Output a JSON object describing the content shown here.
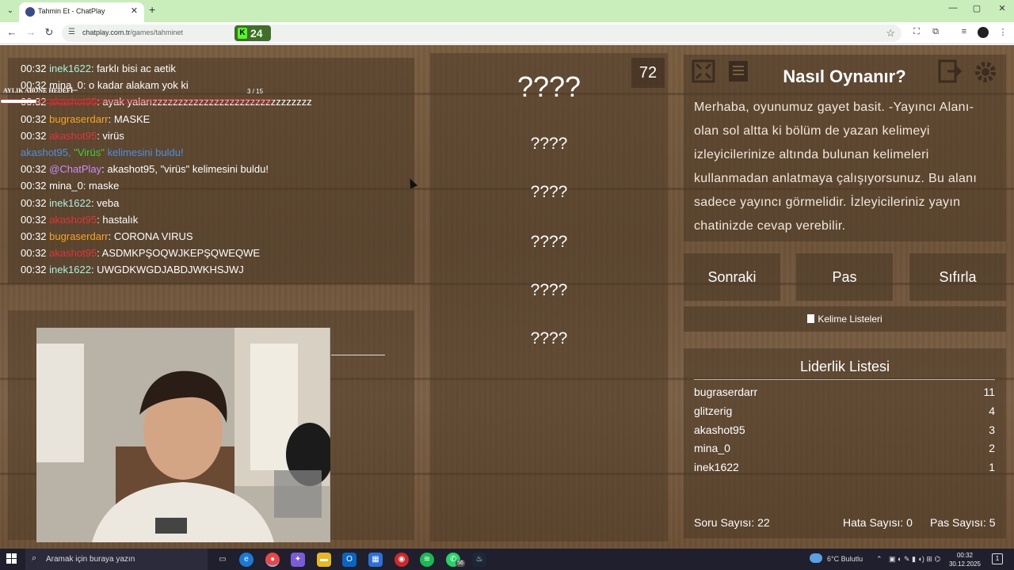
{
  "browser": {
    "tab_title": "Tahmin Et - ChatPlay",
    "tab_close": "✕",
    "new_tab": "+",
    "url_domain": "chatplay.com.tr",
    "url_path": "/games/tahminet",
    "extension_count": "24",
    "window_controls": [
      "—",
      "▢",
      "✕"
    ]
  },
  "chat": {
    "subscriber_goal_label": "AYLIK ABONE HEDEFİ",
    "subscriber_goal_count": "3 / 15",
    "subscriber_goal_progress": 0.13,
    "lines": [
      {
        "time": "00:32",
        "user": "inek1622",
        "user_class": "u-inek",
        "text": ": farklı bisi ac aetik"
      },
      {
        "time": "00:32",
        "user": "mina_0",
        "user_class": "u-mina",
        "text": ": o kadar alakam yok ki"
      },
      {
        "time": "00:32",
        "user": "akashot95",
        "user_class": "u-red",
        "text": ": ayak yalarızzzzzzzzzzzzzzzzzzzzzzzzzzzzzzz"
      },
      {
        "time": "00:32",
        "user": "bugraserdarr",
        "user_class": "u-bugra",
        "text": ": MASKE"
      },
      {
        "time": "00:32",
        "user": "akashot95",
        "user_class": "u-red",
        "text": ": virüs"
      },
      {
        "system": true,
        "pre": "akashot95, ",
        "word": "\"Virüs\"",
        "post": " kelimesini buldu!"
      },
      {
        "time": "00:32",
        "user": "@ChatPlay",
        "user_class": "u-chatplay",
        "text": ": akashot95, \"virüs\" kelimesini buldu!"
      },
      {
        "time": "00:32",
        "user": "mina_0",
        "user_class": "u-mina",
        "text": ": maske"
      },
      {
        "time": "00:32",
        "user": "inek1622",
        "user_class": "u-inek",
        "text": ": veba"
      },
      {
        "time": "00:32",
        "user": "akashot95",
        "user_class": "u-red",
        "text": ": hastalık"
      },
      {
        "time": "00:32",
        "user": "bugraserdarr",
        "user_class": "u-bugra",
        "text": ": CORONA VIRUS"
      },
      {
        "time": "00:32",
        "user": "akashot95",
        "user_class": "u-red",
        "text": ": ASDMKPŞOQWJKEPŞQWEQWE"
      },
      {
        "time": "00:32",
        "user": "inek1622",
        "user_class": "u-inek",
        "text": ": UWGDKWGDJABDJWKHSJWJ"
      }
    ]
  },
  "game": {
    "timer": "72",
    "main_word": "????",
    "hidden_words": [
      "????",
      "????",
      "????",
      "????",
      "????"
    ]
  },
  "help": {
    "title": "Nasıl Oynanır?",
    "text": "Merhaba, oyunumuz gayet basit. -Yayıncı Alanı- olan sol altta ki bölüm de yazan kelimeyi izleyicilerinize altında bulunan kelimeleri kullanmadan anlatmaya çalışıyorsunuz. Bu alanı sadece yayıncı görmelidir. İzleyicileriniz yayın chatinizde cevap verebilir."
  },
  "controls": {
    "next": "Sonraki",
    "pass": "Pas",
    "reset": "Sıfırla",
    "word_lists": "Kelime Listeleri"
  },
  "leaderboard": {
    "title": "Liderlik Listesi",
    "rows": [
      {
        "name": "bugraserdarr",
        "score": "11"
      },
      {
        "name": "glitzerig",
        "score": "4"
      },
      {
        "name": "akashot95",
        "score": "3"
      },
      {
        "name": "mina_0",
        "score": "2"
      },
      {
        "name": "inek1622",
        "score": "1"
      }
    ],
    "questions": "Soru Sayısı: 22",
    "errors": "Hata Sayısı: 0",
    "passes": "Pas Sayısı: 5"
  },
  "taskbar": {
    "search_placeholder": "Aramak için buraya yazın",
    "weather": "6°C  Bulutlu",
    "time": "00:32",
    "date": "30.12.2025",
    "notification_count": "1",
    "whatsapp_badge": "56"
  },
  "colors": {
    "inek": "#a8f0e0",
    "bugra": "#f5a623",
    "akashot": "#e0333a",
    "chatplay": "#c98cff",
    "system": "#4a90e2"
  }
}
